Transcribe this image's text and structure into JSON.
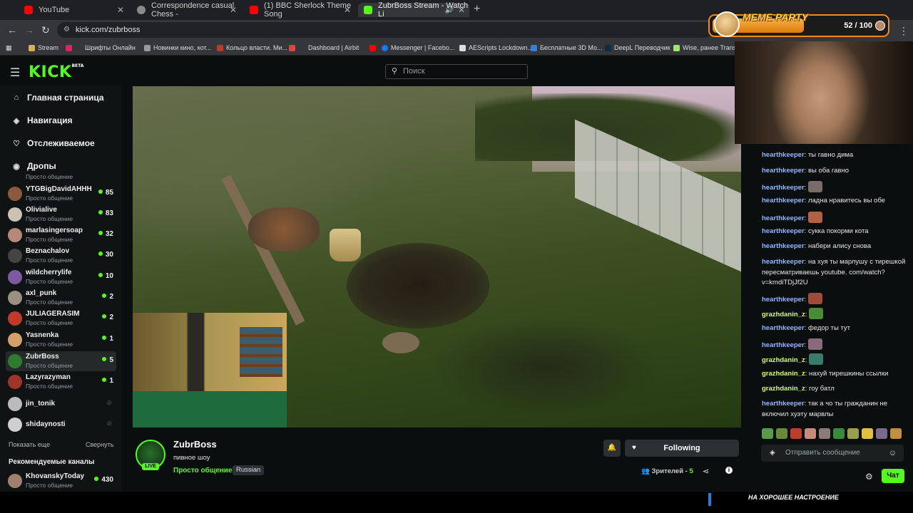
{
  "browser": {
    "tabs": [
      {
        "label": "YouTube",
        "color": "#ff0000"
      },
      {
        "label": "Correspondence casual Chess -",
        "color": "#8a8a8a"
      },
      {
        "label": "(1) BBC Sherlock Theme Song",
        "color": "#ff0000"
      },
      {
        "label": "ZubrBoss Stream - Watch Li",
        "color": "#53fc18"
      }
    ],
    "url": "kick.com/zubrboss",
    "bookmarks": [
      "Stream",
      "Шрифты Онлайн",
      "Новинки кино, кот...",
      "Кольцо власти. Ми...",
      "Dashboard | Airbit",
      "Messenger | Facebo...",
      "AEScripts Lockdown...",
      "Бесплатные 3D Мо...",
      "DeepL Переводчик",
      "Wise, ранее Transfe..."
    ]
  },
  "overlay": {
    "title": "MEME PARTY",
    "count": "52 / 100",
    "progress": 0.52
  },
  "kick": {
    "logo": "KICK",
    "beta": "BETA",
    "search_placeholder": "Поиск"
  },
  "sidebar": {
    "nav": [
      {
        "label": "Главная страница",
        "icon": "home-icon"
      },
      {
        "label": "Навигация",
        "icon": "compass-icon"
      },
      {
        "label": "Отслеживаемое",
        "icon": "heart-icon"
      },
      {
        "label": "Дропы",
        "icon": "gift-icon"
      }
    ],
    "partial_category": "Просто общение",
    "channels": [
      {
        "name": "YTGBigDavidAHHH",
        "category": "Просто общение",
        "viewers": "85",
        "color": "#8a5a3a"
      },
      {
        "name": "Olivialive",
        "category": "Просто общение",
        "viewers": "83",
        "color": "#c9c2b5"
      },
      {
        "name": "marlasingersoap",
        "category": "Просто общение",
        "viewers": "32",
        "color": "#b5897a"
      },
      {
        "name": "Beznachalov",
        "category": "Просто общение",
        "viewers": "30",
        "color": "#444"
      },
      {
        "name": "wildcherrylife",
        "category": "Просто общение",
        "viewers": "10",
        "color": "#7c5aa0"
      },
      {
        "name": "axl_punk",
        "category": "Просто общение",
        "viewers": "2",
        "color": "#9a8f83"
      },
      {
        "name": "JULIAGERASIM",
        "category": "Просто общение",
        "viewers": "2",
        "color": "#c0392b"
      },
      {
        "name": "Yasnenka",
        "category": "Просто общение",
        "viewers": "1",
        "color": "#d4a06a"
      },
      {
        "name": "ZubrBoss",
        "category": "Просто общение",
        "viewers": "5",
        "color": "#2f7a2f"
      },
      {
        "name": "Lazyrazyman",
        "category": "Просто общение",
        "viewers": "1",
        "color": "#a0342a"
      },
      {
        "name": "jin_tonik",
        "category": "",
        "viewers": "",
        "color": "#bbb"
      },
      {
        "name": "shidaynosti",
        "category": "",
        "viewers": "",
        "color": "#cfcfcf"
      }
    ],
    "show_more": "Показать еще",
    "collapse": "Свернуть",
    "recommended_title": "Рекомендуемые каналы",
    "recommended": {
      "name": "KhovanskyToday",
      "category": "Просто общение",
      "viewers": "430"
    }
  },
  "channel": {
    "name": "ZubrBoss",
    "live": "LIVE",
    "title": "пивное шоу",
    "category": "Просто общение",
    "language": "Russian",
    "follow_label": "Following",
    "viewers_label": "Зрителей -",
    "viewers": "5"
  },
  "chat": {
    "messages": [
      {
        "user": "hearthkeeper",
        "text": ": ты гавно дима"
      },
      {
        "user": "hearthkeeper",
        "text": ": вы оба гавно"
      },
      {
        "user": "hearthkeeper",
        "text": ":",
        "emote": "#7a6a6a"
      },
      {
        "user": "hearthkeeper",
        "text": ": ладна нравитесь вы обе"
      },
      {
        "user": "hearthkeeper",
        "text": ":",
        "emote": "#b0604a"
      },
      {
        "user": "hearthkeeper",
        "text": ": сукка покорми кота"
      },
      {
        "user": "hearthkeeper",
        "text": ": набери алису снова"
      },
      {
        "user": "hearthkeeper",
        "text": ": на хуя ты марлушу с тирешкой пересматриваешь youtube. com/watch?v=kmdiTDjJf2U"
      },
      {
        "user": "hearthkeeper",
        "text": ":",
        "emote": "#a04a3a"
      },
      {
        "user": "grazhdanin_z",
        "text": ":",
        "emote": "#4a8a3a"
      },
      {
        "user": "hearthkeeper",
        "text": ": федор ты тут"
      },
      {
        "user": "hearthkeeper",
        "text": ":",
        "emote": "#8a6a7a"
      },
      {
        "user": "grazhdanin_z",
        "text": ":",
        "emote": "#3a7a6a"
      },
      {
        "user": "grazhdanin_z",
        "text": ": нахуй тирешкины ссылки"
      },
      {
        "user": "grazhdanin_z",
        "text": ": гоу батл"
      },
      {
        "user": "hearthkeeper",
        "text": ": так а чо ты гражданин не включил хуэту марвлы"
      }
    ],
    "input_placeholder": "Отправить сообщение",
    "send_label": "Чат"
  },
  "footer": {
    "mood": "НА ХОРОШЕЕ НАСТРОЕНИЕ"
  }
}
